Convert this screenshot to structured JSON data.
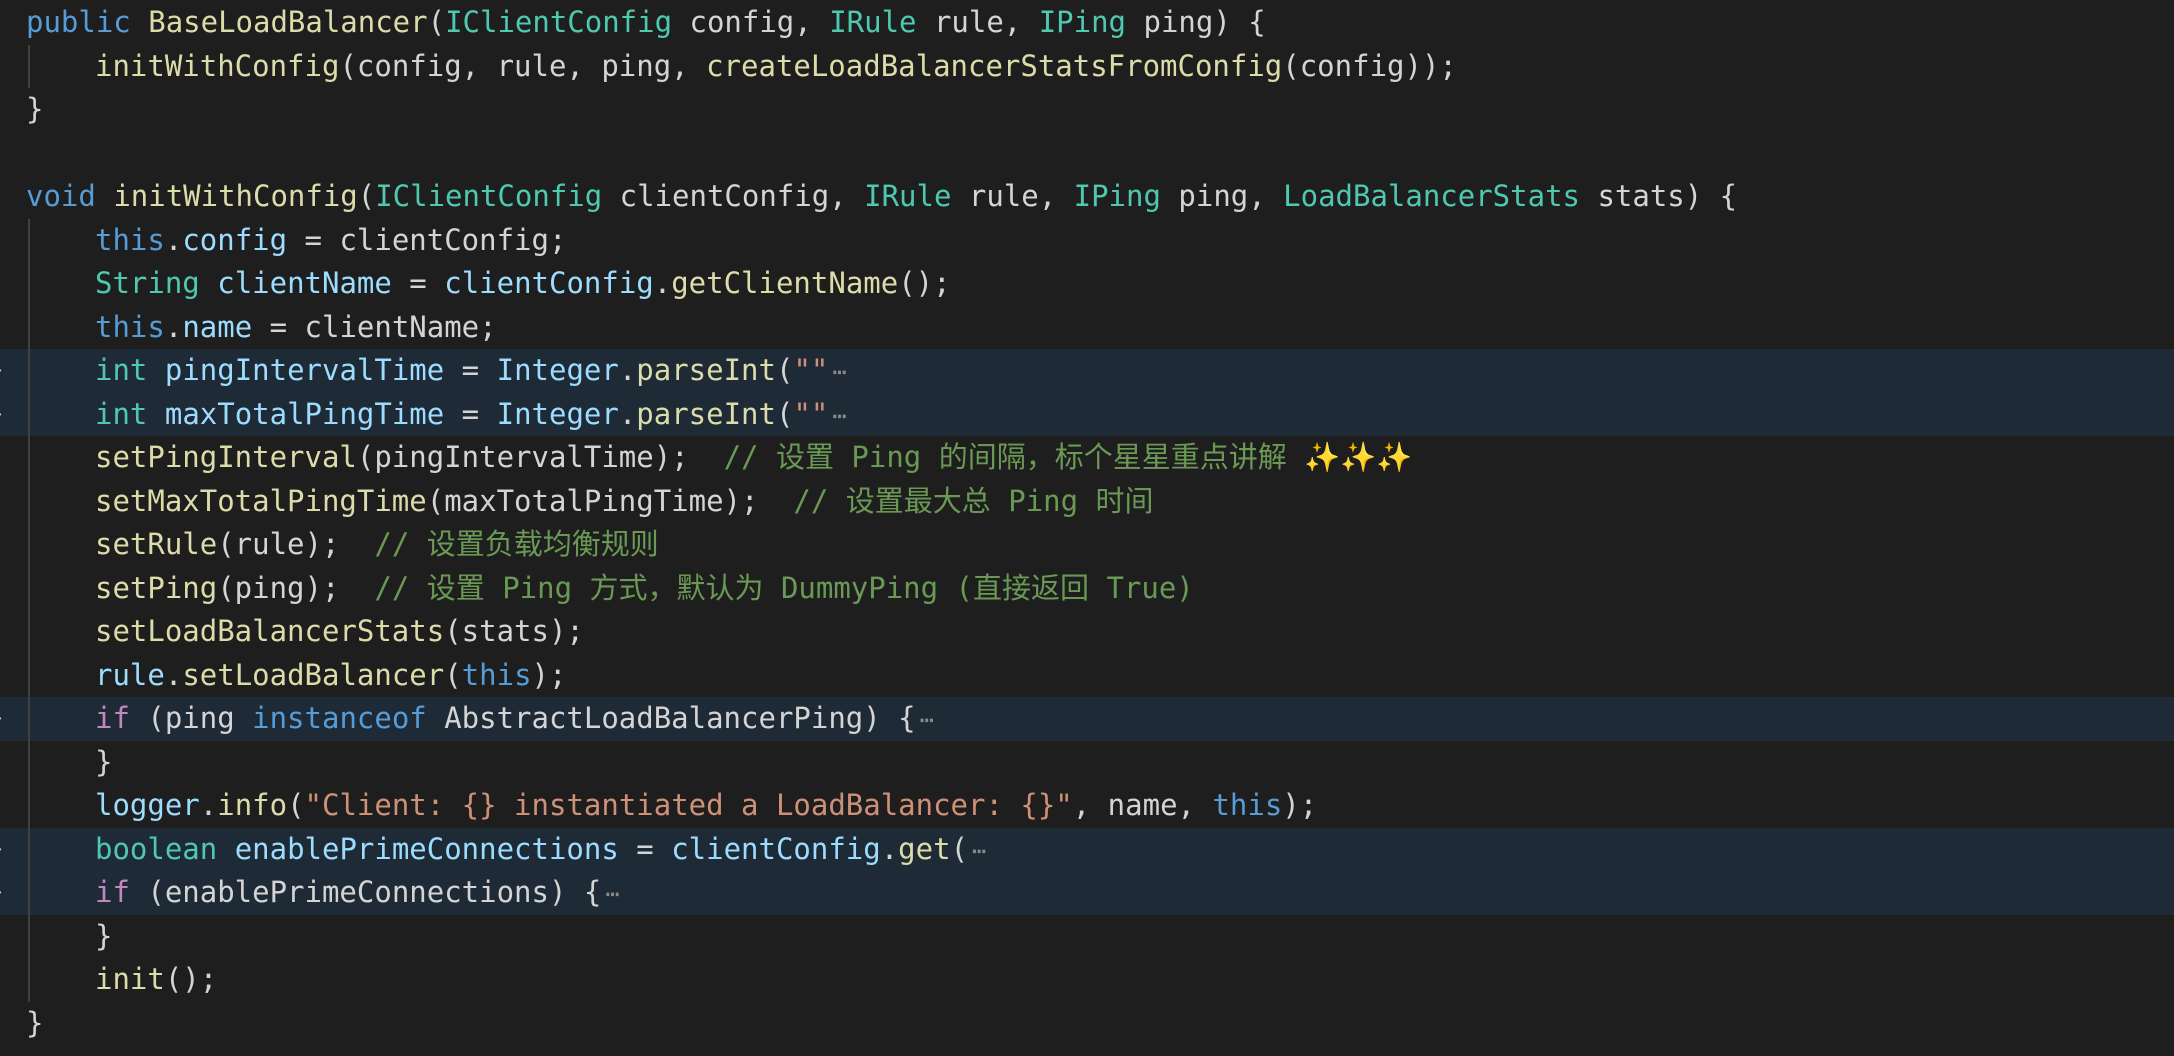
{
  "editor": {
    "language": "java",
    "colors": {
      "background": "#1e1e1e",
      "folded_highlight": "#1f2a37",
      "keyword": "#569cd6",
      "control": "#c586c0",
      "type": "#4ec9b0",
      "function": "#dcdcaa",
      "variable": "#9cdcfe",
      "string": "#ce9178",
      "comment": "#6a9955",
      "plain": "#d4d4d4"
    },
    "fold_icon": "chevron-right-icon",
    "fold_ellipsis": "⋯",
    "lines": [
      {
        "indent": 0,
        "folded": false,
        "tokens": [
          {
            "t": "public",
            "c": "kw"
          },
          {
            "t": " ",
            "c": "pl"
          },
          {
            "t": "BaseLoadBalancer",
            "c": "fn"
          },
          {
            "t": "(",
            "c": "pl"
          },
          {
            "t": "IClientConfig",
            "c": "ty"
          },
          {
            "t": " config, ",
            "c": "pl"
          },
          {
            "t": "IRule",
            "c": "ty"
          },
          {
            "t": " rule, ",
            "c": "pl"
          },
          {
            "t": "IPing",
            "c": "ty"
          },
          {
            "t": " ping) {",
            "c": "pl"
          }
        ]
      },
      {
        "indent": 1,
        "folded": false,
        "tokens": [
          {
            "t": "initWithConfig",
            "c": "fn"
          },
          {
            "t": "(config, rule, ping, ",
            "c": "pl"
          },
          {
            "t": "createLoadBalancerStatsFromConfig",
            "c": "fn"
          },
          {
            "t": "(config));",
            "c": "pl"
          }
        ]
      },
      {
        "indent": 0,
        "folded": false,
        "tokens": [
          {
            "t": "}",
            "c": "pl"
          }
        ]
      },
      {
        "indent": 0,
        "folded": false,
        "tokens": []
      },
      {
        "indent": 0,
        "folded": false,
        "tokens": [
          {
            "t": "void",
            "c": "kw"
          },
          {
            "t": " ",
            "c": "pl"
          },
          {
            "t": "initWithConfig",
            "c": "fn"
          },
          {
            "t": "(",
            "c": "pl"
          },
          {
            "t": "IClientConfig",
            "c": "ty"
          },
          {
            "t": " clientConfig, ",
            "c": "pl"
          },
          {
            "t": "IRule",
            "c": "ty"
          },
          {
            "t": " rule, ",
            "c": "pl"
          },
          {
            "t": "IPing",
            "c": "ty"
          },
          {
            "t": " ping, ",
            "c": "pl"
          },
          {
            "t": "LoadBalancerStats",
            "c": "ty"
          },
          {
            "t": " stats) {",
            "c": "pl"
          }
        ]
      },
      {
        "indent": 1,
        "folded": false,
        "tokens": [
          {
            "t": "this",
            "c": "kw"
          },
          {
            "t": ".",
            "c": "pl"
          },
          {
            "t": "config",
            "c": "var"
          },
          {
            "t": " = clientConfig;",
            "c": "pl"
          }
        ]
      },
      {
        "indent": 1,
        "folded": false,
        "tokens": [
          {
            "t": "String",
            "c": "ty"
          },
          {
            "t": " ",
            "c": "pl"
          },
          {
            "t": "clientName",
            "c": "var"
          },
          {
            "t": " = ",
            "c": "pl"
          },
          {
            "t": "clientConfig",
            "c": "var"
          },
          {
            "t": ".",
            "c": "pl"
          },
          {
            "t": "getClientName",
            "c": "fn"
          },
          {
            "t": "();",
            "c": "pl"
          }
        ]
      },
      {
        "indent": 1,
        "folded": false,
        "tokens": [
          {
            "t": "this",
            "c": "kw"
          },
          {
            "t": ".",
            "c": "pl"
          },
          {
            "t": "name",
            "c": "var"
          },
          {
            "t": " = clientName;",
            "c": "pl"
          }
        ]
      },
      {
        "indent": 1,
        "folded": true,
        "tokens": [
          {
            "t": "int",
            "c": "ty"
          },
          {
            "t": " ",
            "c": "pl"
          },
          {
            "t": "pingIntervalTime",
            "c": "var"
          },
          {
            "t": " = ",
            "c": "pl"
          },
          {
            "t": "Integer",
            "c": "var"
          },
          {
            "t": ".",
            "c": "pl"
          },
          {
            "t": "parseInt",
            "c": "fn"
          },
          {
            "t": "(",
            "c": "pl"
          },
          {
            "t": "\"\"",
            "c": "str"
          }
        ]
      },
      {
        "indent": 1,
        "folded": true,
        "tokens": [
          {
            "t": "int",
            "c": "ty"
          },
          {
            "t": " ",
            "c": "pl"
          },
          {
            "t": "maxTotalPingTime",
            "c": "var"
          },
          {
            "t": " = ",
            "c": "pl"
          },
          {
            "t": "Integer",
            "c": "var"
          },
          {
            "t": ".",
            "c": "pl"
          },
          {
            "t": "parseInt",
            "c": "fn"
          },
          {
            "t": "(",
            "c": "pl"
          },
          {
            "t": "\"\"",
            "c": "str"
          }
        ]
      },
      {
        "indent": 1,
        "folded": false,
        "tokens": [
          {
            "t": "setPingInterval",
            "c": "fn"
          },
          {
            "t": "(pingIntervalTime);  ",
            "c": "pl"
          },
          {
            "t": "// 设置 Ping 的间隔，标个星星重点讲解 ",
            "c": "cm"
          },
          {
            "t": "✨✨✨",
            "c": "emoji"
          }
        ]
      },
      {
        "indent": 1,
        "folded": false,
        "tokens": [
          {
            "t": "setMaxTotalPingTime",
            "c": "fn"
          },
          {
            "t": "(maxTotalPingTime);  ",
            "c": "pl"
          },
          {
            "t": "// 设置最大总 Ping 时间",
            "c": "cm"
          }
        ]
      },
      {
        "indent": 1,
        "folded": false,
        "tokens": [
          {
            "t": "setRule",
            "c": "fn"
          },
          {
            "t": "(rule);  ",
            "c": "pl"
          },
          {
            "t": "// 设置负载均衡规则",
            "c": "cm"
          }
        ]
      },
      {
        "indent": 1,
        "folded": false,
        "tokens": [
          {
            "t": "setPing",
            "c": "fn"
          },
          {
            "t": "(ping);  ",
            "c": "pl"
          },
          {
            "t": "// 设置 Ping 方式，默认为 DummyPing (直接返回 True)",
            "c": "cm"
          }
        ]
      },
      {
        "indent": 1,
        "folded": false,
        "tokens": [
          {
            "t": "setLoadBalancerStats",
            "c": "fn"
          },
          {
            "t": "(stats);",
            "c": "pl"
          }
        ]
      },
      {
        "indent": 1,
        "folded": false,
        "tokens": [
          {
            "t": "rule",
            "c": "var"
          },
          {
            "t": ".",
            "c": "pl"
          },
          {
            "t": "setLoadBalancer",
            "c": "fn"
          },
          {
            "t": "(",
            "c": "pl"
          },
          {
            "t": "this",
            "c": "kw"
          },
          {
            "t": ");",
            "c": "pl"
          }
        ]
      },
      {
        "indent": 1,
        "folded": true,
        "tokens": [
          {
            "t": "if",
            "c": "ctl"
          },
          {
            "t": " (ping ",
            "c": "pl"
          },
          {
            "t": "instanceof",
            "c": "kw"
          },
          {
            "t": " AbstractLoadBalancerPing) {",
            "c": "pl"
          }
        ]
      },
      {
        "indent": 1,
        "folded": false,
        "tokens": [
          {
            "t": "}",
            "c": "pl"
          }
        ]
      },
      {
        "indent": 1,
        "folded": false,
        "tokens": [
          {
            "t": "logger",
            "c": "var"
          },
          {
            "t": ".",
            "c": "pl"
          },
          {
            "t": "info",
            "c": "fn"
          },
          {
            "t": "(",
            "c": "pl"
          },
          {
            "t": "\"Client: {} instantiated a LoadBalancer: {}\"",
            "c": "str"
          },
          {
            "t": ", name, ",
            "c": "pl"
          },
          {
            "t": "this",
            "c": "kw"
          },
          {
            "t": ");",
            "c": "pl"
          }
        ]
      },
      {
        "indent": 1,
        "folded": true,
        "tokens": [
          {
            "t": "boolean",
            "c": "ty"
          },
          {
            "t": " ",
            "c": "pl"
          },
          {
            "t": "enablePrimeConnections",
            "c": "var"
          },
          {
            "t": " = ",
            "c": "pl"
          },
          {
            "t": "clientConfig",
            "c": "var"
          },
          {
            "t": ".",
            "c": "pl"
          },
          {
            "t": "get",
            "c": "fn"
          },
          {
            "t": "(",
            "c": "pl"
          }
        ]
      },
      {
        "indent": 1,
        "folded": true,
        "tokens": [
          {
            "t": "if",
            "c": "ctl"
          },
          {
            "t": " (enablePrimeConnections) {",
            "c": "pl"
          }
        ]
      },
      {
        "indent": 1,
        "folded": false,
        "tokens": [
          {
            "t": "}",
            "c": "pl"
          }
        ]
      },
      {
        "indent": 1,
        "folded": false,
        "tokens": [
          {
            "t": "init",
            "c": "fn"
          },
          {
            "t": "();",
            "c": "pl"
          }
        ]
      },
      {
        "indent": 0,
        "folded": false,
        "tokens": [
          {
            "t": "}",
            "c": "pl"
          }
        ]
      }
    ]
  }
}
